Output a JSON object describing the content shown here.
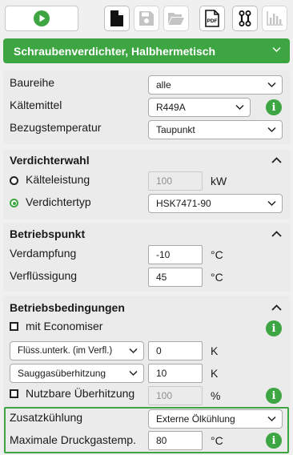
{
  "toolbar": {
    "buttons": [
      {
        "icon": "play-icon",
        "color": "#3da541"
      },
      {
        "icon": "new-document-icon"
      },
      {
        "icon": "save-icon"
      },
      {
        "icon": "open-folder-icon"
      },
      {
        "icon": "pdf-export-icon",
        "label": "PDF"
      },
      {
        "icon": "compare-icon"
      },
      {
        "icon": "bar-chart-icon"
      }
    ]
  },
  "title": "Schraubenverdichter, Halbhermetisch",
  "accent_color": "#3da541",
  "general": {
    "baureihe": {
      "label": "Baureihe",
      "value": "alle"
    },
    "kaeltemittel": {
      "label": "Kältemittel",
      "value": "R449A"
    },
    "bezugstemperatur": {
      "label": "Bezugstemperatur",
      "value": "Taupunkt"
    }
  },
  "verdichterwahl": {
    "heading": "Verdichterwahl",
    "kaelteleistung": {
      "label": "Kälteleistung",
      "value": "100",
      "unit": "kW",
      "selected": false
    },
    "verdichtertyp": {
      "label": "Verdichtertyp",
      "value": "HSK7471-90",
      "selected": true
    }
  },
  "betriebspunkt": {
    "heading": "Betriebspunkt",
    "verdampfung": {
      "label": "Verdampfung",
      "value": "-10",
      "unit": "°C"
    },
    "verfluessigung": {
      "label": "Verflüssigung",
      "value": "45",
      "unit": "°C"
    }
  },
  "betriebsbedingungen": {
    "heading": "Betriebsbedingungen",
    "economiser": {
      "label": "mit Economiser",
      "checked": false
    },
    "fluess": {
      "select": "Flüss.unterk. (im Verfl.)",
      "value": "0",
      "unit": "K"
    },
    "sauggas": {
      "select": "Sauggasüberhitzung",
      "value": "10",
      "unit": "K"
    },
    "nutzbare": {
      "label": "Nutzbare Überhitzung",
      "value": "100",
      "unit": "%",
      "checked": false
    },
    "zusatzkuehlung": {
      "label": "Zusatzkühlung",
      "value": "Externe Ölkühlung"
    },
    "druckgastemp": {
      "label": "Maximale Druckgastemp.",
      "value": "80",
      "unit": "°C"
    }
  },
  "info_symbol": "i"
}
